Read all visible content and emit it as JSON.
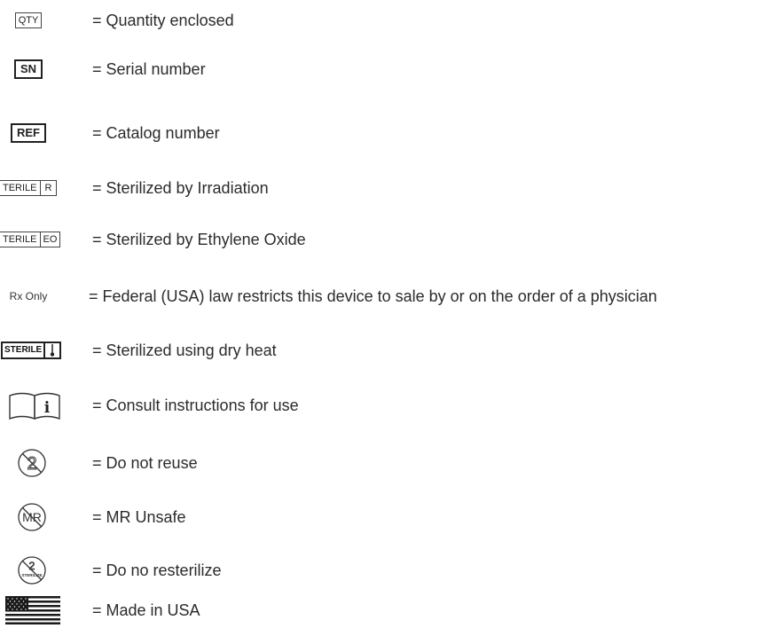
{
  "rows": [
    {
      "symbol": "QTY",
      "description": "= Quantity enclosed"
    },
    {
      "symbol": "SN",
      "description": "= Serial number"
    },
    {
      "symbol": "REF",
      "description": "= Catalog number"
    },
    {
      "symbol": [
        "TERILE",
        "R"
      ],
      "description": "= Sterilized by Irradiation"
    },
    {
      "symbol": [
        "TERILE",
        "EO"
      ],
      "description": "= Sterilized by Ethylene Oxide"
    },
    {
      "symbol": "Rx Only",
      "description": "= Federal (USA) law restricts this device to sale by or on the order of a physician"
    },
    {
      "symbol": "STERILE",
      "description": "= Sterilized using dry heat"
    },
    {
      "symbol": "i",
      "description": "= Consult instructions for use"
    },
    {
      "symbol": "2",
      "description": "= Do not reuse"
    },
    {
      "symbol": "MR",
      "description": "= MR Unsafe"
    },
    {
      "symbol": [
        "2",
        "STERILIZE"
      ],
      "description": "= Do no resterilize"
    },
    {
      "symbol": "us-flag-icon",
      "description": "= Made in USA"
    }
  ]
}
